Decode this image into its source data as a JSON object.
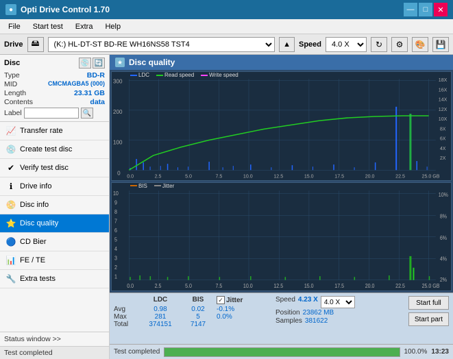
{
  "app": {
    "title": "Opti Drive Control 1.70",
    "icon": "●"
  },
  "titlebar": {
    "minimize": "—",
    "maximize": "□",
    "close": "✕"
  },
  "menubar": {
    "items": [
      "File",
      "Start test",
      "Extra",
      "Help"
    ]
  },
  "drivebar": {
    "label": "Drive",
    "drive_value": "(K:)  HL-DT-ST BD-RE  WH16NS58 TST4",
    "eject_label": "▲",
    "speed_label": "Speed",
    "speed_value": "4.0 X"
  },
  "disc": {
    "title": "Disc",
    "type_label": "Type",
    "type_value": "BD-R",
    "mid_label": "MID",
    "mid_value": "CMCMAGBA5 (000)",
    "length_label": "Length",
    "length_value": "23.31 GB",
    "contents_label": "Contents",
    "contents_value": "data",
    "label_label": "Label"
  },
  "nav": {
    "items": [
      {
        "id": "transfer-rate",
        "label": "Transfer rate",
        "icon": "📈"
      },
      {
        "id": "create-test-disc",
        "label": "Create test disc",
        "icon": "💿"
      },
      {
        "id": "verify-test-disc",
        "label": "Verify test disc",
        "icon": "✔"
      },
      {
        "id": "drive-info",
        "label": "Drive info",
        "icon": "ℹ"
      },
      {
        "id": "disc-info",
        "label": "Disc info",
        "icon": "📀"
      },
      {
        "id": "disc-quality",
        "label": "Disc quality",
        "icon": "⭐",
        "active": true
      },
      {
        "id": "cd-bier",
        "label": "CD Bier",
        "icon": "🔵"
      },
      {
        "id": "fe-te",
        "label": "FE / TE",
        "icon": "📊"
      },
      {
        "id": "extra-tests",
        "label": "Extra tests",
        "icon": "🔧"
      }
    ]
  },
  "disc_quality": {
    "title": "Disc quality",
    "legend": {
      "ldc_label": "LDC",
      "read_speed_label": "Read speed",
      "write_speed_label": "Write speed",
      "bis_label": "BIS",
      "jitter_label": "Jitter"
    },
    "chart1": {
      "y_max": 300,
      "y_labels_left": [
        "300",
        "200",
        "100",
        "0"
      ],
      "y_labels_right": [
        "18X",
        "16X",
        "14X",
        "12X",
        "10X",
        "8X",
        "6X",
        "4X",
        "2X"
      ],
      "x_labels": [
        "0.0",
        "2.5",
        "5.0",
        "7.5",
        "10.0",
        "12.5",
        "15.0",
        "17.5",
        "20.0",
        "22.5",
        "25.0 GB"
      ]
    },
    "chart2": {
      "y_max": 10,
      "y_labels_left": [
        "10",
        "9",
        "8",
        "7",
        "6",
        "5",
        "4",
        "3",
        "2",
        "1"
      ],
      "y_labels_right": [
        "10%",
        "8%",
        "6%",
        "4%",
        "2%"
      ],
      "x_labels": [
        "0.0",
        "2.5",
        "5.0",
        "7.5",
        "10.0",
        "12.5",
        "15.0",
        "17.5",
        "20.0",
        "22.5",
        "25.0 GB"
      ]
    }
  },
  "stats": {
    "ldc_header": "LDC",
    "bis_header": "BIS",
    "jitter_header": "Jitter",
    "avg_label": "Avg",
    "max_label": "Max",
    "total_label": "Total",
    "avg_ldc": "0.98",
    "avg_bis": "0.02",
    "avg_jitter": "-0.1%",
    "max_ldc": "281",
    "max_bis": "5",
    "max_jitter": "0.0%",
    "total_ldc": "374151",
    "total_bis": "7147",
    "speed_label": "Speed",
    "speed_value": "4.23 X",
    "speed_select": "4.0 X",
    "position_label": "Position",
    "position_value": "23862 MB",
    "samples_label": "Samples",
    "samples_value": "381622",
    "jitter_checkbox_label": "Jitter",
    "start_full_label": "Start full",
    "start_part_label": "Start part"
  },
  "status": {
    "text": "Test completed",
    "progress_value": 100,
    "progress_text": "100.0%",
    "time": "13:23"
  },
  "sidebar_status": {
    "label": "Status window >>"
  }
}
